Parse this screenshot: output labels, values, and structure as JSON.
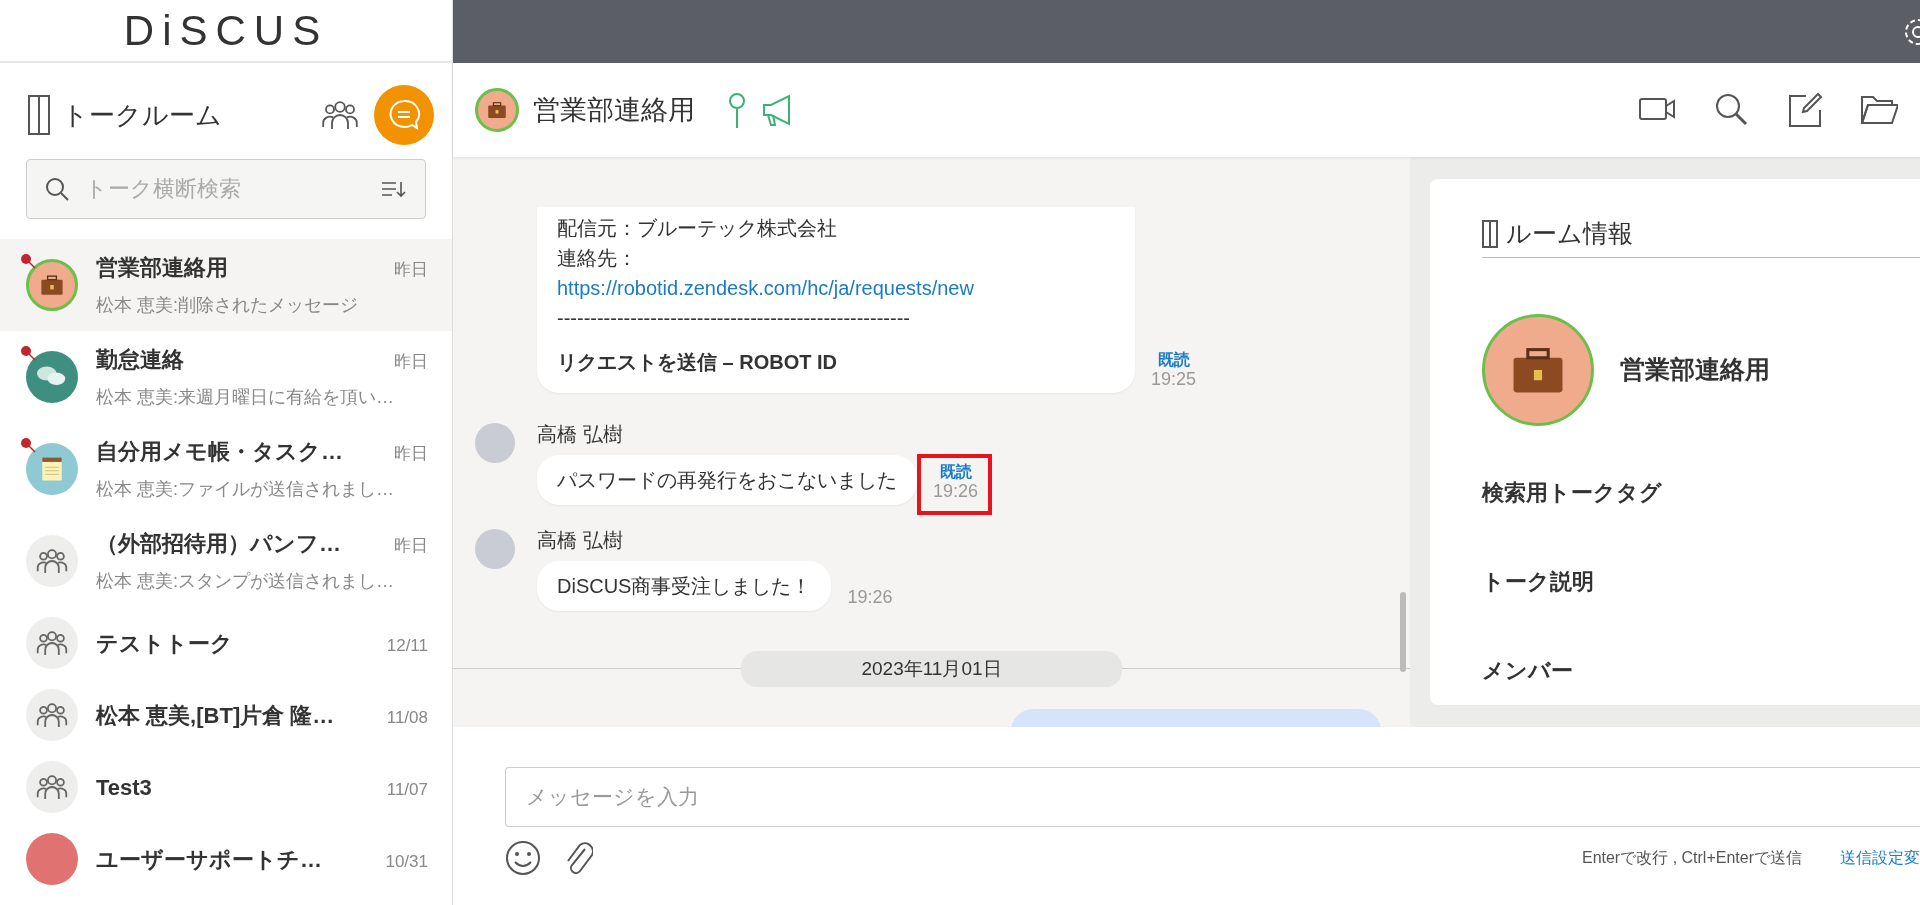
{
  "logo": {
    "text": "DiSCUS"
  },
  "sidebar": {
    "title": "トークルーム",
    "search": {
      "placeholder": "トーク横断検索"
    },
    "rooms": [
      {
        "name": "営業部連絡用",
        "time": "昨日",
        "preview": "松本 恵美:削除されたメッセージ",
        "kind": "briefcase",
        "pinned": true,
        "selected": true
      },
      {
        "name": "勤怠連絡",
        "time": "昨日",
        "preview": "松本 恵美:来週月曜日に有給を頂い…",
        "kind": "chat",
        "pinned": true,
        "selected": false
      },
      {
        "name": "自分用メモ帳・タスク…",
        "time": "昨日",
        "preview": "松本 恵美:ファイルが送信されまし…",
        "kind": "notepad",
        "pinned": true,
        "selected": false
      },
      {
        "name": "（外部招待用）パンフ…",
        "time": "昨日",
        "preview": "松本 恵美:スタンプが送信されまし…",
        "kind": "group",
        "pinned": false,
        "selected": false
      },
      {
        "name": "テストトーク",
        "time": "12/11",
        "kind": "group",
        "pinned": false,
        "selected": false
      },
      {
        "name": "松本 恵美,[BT]片倉 隆…",
        "time": "11/08",
        "kind": "group",
        "pinned": false,
        "selected": false
      },
      {
        "name": "Test3",
        "time": "11/07",
        "kind": "group",
        "pinned": false,
        "selected": false
      },
      {
        "name": "ユーザーサポートチ…",
        "time": "10/31",
        "kind": "red",
        "pinned": false,
        "selected": false
      }
    ]
  },
  "chat": {
    "title": "営業部連絡用",
    "messages": [
      {
        "kind": "notice",
        "lines": [
          "配信元：ブルーテック株式会社",
          "連絡先："
        ],
        "link": "https://robotid.zendesk.com/hc/ja/requests/new",
        "rule": "-----------------------------------------------------",
        "footer": "リクエストを送信 – ROBOT ID",
        "read": "既読",
        "time": "19:25",
        "highlighted": false
      },
      {
        "kind": "text",
        "sender": "高橋 弘樹",
        "text": "パスワードの再発行をおこないました",
        "read": "既読",
        "time": "19:26",
        "highlighted": true
      },
      {
        "kind": "text",
        "sender": "高橋 弘樹",
        "text": "DiSCUS商事受注しました！",
        "time": "19:26",
        "highlighted": false
      },
      {
        "kind": "date",
        "text": "2023年11月01日"
      },
      {
        "kind": "outgoing"
      }
    ],
    "input": {
      "placeholder": "メッセージを入力"
    },
    "hint": "Enterで改行 , Ctrl+Enterで送信",
    "settings_link": "送信設定変"
  },
  "room_info": {
    "title": "ルーム情報",
    "name": "営業部連絡用",
    "sections": [
      "検索用トークタグ",
      "トーク説明",
      "メンバー"
    ]
  }
}
